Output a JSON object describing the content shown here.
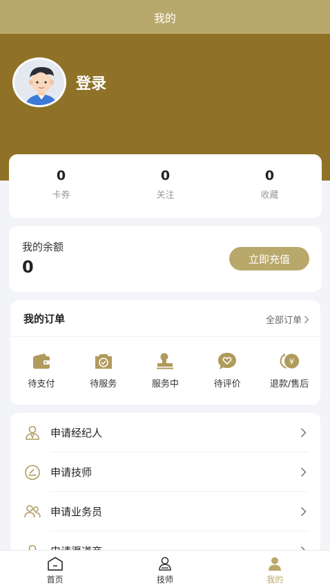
{
  "header": {
    "title": "我的"
  },
  "profile": {
    "login_label": "登录"
  },
  "stats": [
    {
      "value": "0",
      "label": "卡券"
    },
    {
      "value": "0",
      "label": "关注"
    },
    {
      "value": "0",
      "label": "收藏"
    }
  ],
  "balance": {
    "label": "我的余额",
    "value": "0",
    "recharge_label": "立即充值"
  },
  "orders": {
    "title": "我的订单",
    "all_label": "全部订单",
    "items": [
      {
        "label": "待支付",
        "icon": "wallet-icon"
      },
      {
        "label": "待服务",
        "icon": "camera-check-icon"
      },
      {
        "label": "服务中",
        "icon": "stamp-icon"
      },
      {
        "label": "待评价",
        "icon": "heart-bubble-icon"
      },
      {
        "label": "退款/售后",
        "icon": "yen-refund-icon"
      }
    ]
  },
  "menu": [
    {
      "label": "申请经纪人",
      "icon": "agent-icon"
    },
    {
      "label": "申请技师",
      "icon": "technician-icon"
    },
    {
      "label": "申请业务员",
      "icon": "salesperson-icon"
    },
    {
      "label": "申请渠道商",
      "icon": "channel-icon"
    }
  ],
  "tabbar": [
    {
      "label": "首页",
      "icon": "home-icon"
    },
    {
      "label": "技师",
      "icon": "technician-tab-icon"
    },
    {
      "label": "我的",
      "icon": "profile-icon",
      "active": true
    }
  ],
  "colors": {
    "gold": "#b9a86b",
    "brown": "#8f7228",
    "icon_gold": "#b09a5c"
  }
}
